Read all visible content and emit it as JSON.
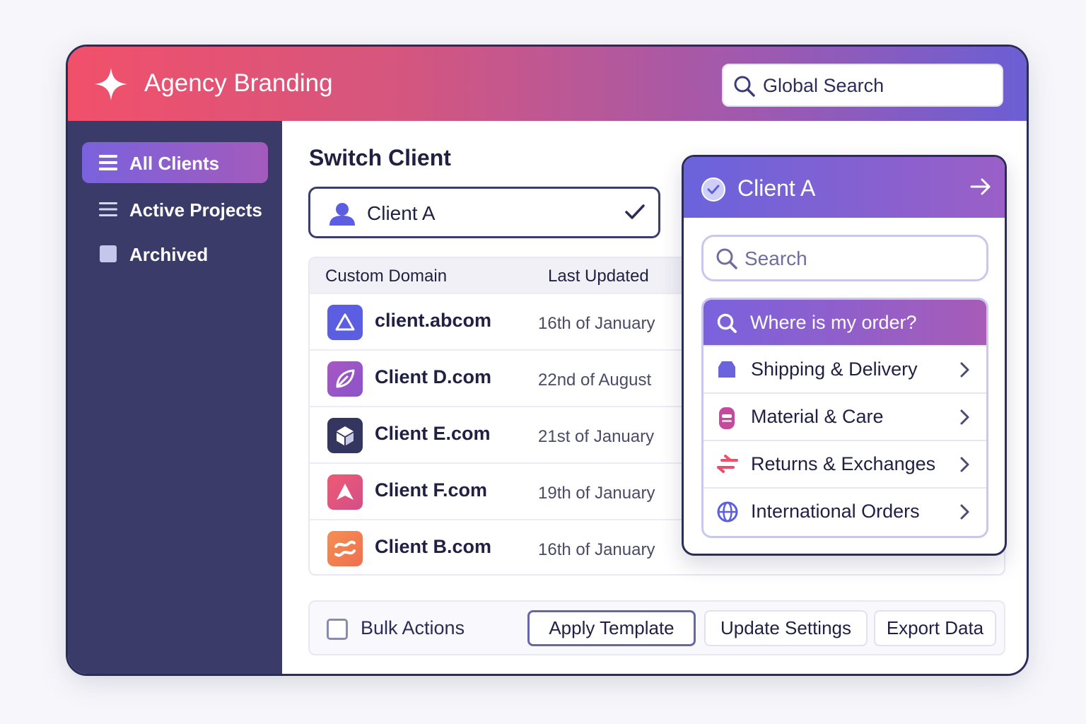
{
  "header": {
    "brand": "Agency Branding",
    "search_placeholder": "Global Search"
  },
  "sidebar": {
    "items": [
      {
        "label": "All Clients",
        "icon": "menu-icon",
        "active": true
      },
      {
        "label": "Active Projects",
        "icon": "menu-icon",
        "active": false
      },
      {
        "label": "Archived",
        "icon": "archive-square-icon",
        "active": false
      }
    ]
  },
  "switch": {
    "title": "Switch Client",
    "selected": "Client A"
  },
  "table": {
    "columns": [
      "Custom Domain",
      "Last Updated"
    ],
    "rows": [
      {
        "domain": "client.abcom",
        "updated": "16th of January",
        "icon": "triangle-icon",
        "color": "#5b5ee0"
      },
      {
        "domain": "Client D.com",
        "updated": "22nd of August",
        "icon": "leaf-icon",
        "color": "#9a55c4"
      },
      {
        "domain": "Client E.com",
        "updated": "21st of January",
        "icon": "cube-icon",
        "color": "#34365f"
      },
      {
        "domain": "Client F.com",
        "updated": "19th of January",
        "icon": "arrow-up-icon",
        "color": "#e8557a"
      },
      {
        "domain": "Client B.com",
        "updated": "16th of January",
        "icon": "wave-icon",
        "color": "#f07a4a"
      }
    ]
  },
  "actions": {
    "bulk_label": "Bulk Actions",
    "apply_template": "Apply Template",
    "update_settings": "Update Settings",
    "export_data": "Export Data"
  },
  "popup": {
    "client": "Client A",
    "search_placeholder": "Search",
    "faq_title": "Where is my order?",
    "items": [
      {
        "label": "Shipping & Delivery",
        "icon": "box-icon"
      },
      {
        "label": "Material & Care",
        "icon": "bottle-icon"
      },
      {
        "label": "Returns & Exchanges",
        "icon": "exchange-icon"
      },
      {
        "label": "International Orders",
        "icon": "globe-icon"
      }
    ]
  },
  "colors": {
    "header_start": "#f1506a",
    "header_end": "#6b5fd4",
    "sidebar_bg": "#3a3b69",
    "accent": "#7a62dd"
  }
}
